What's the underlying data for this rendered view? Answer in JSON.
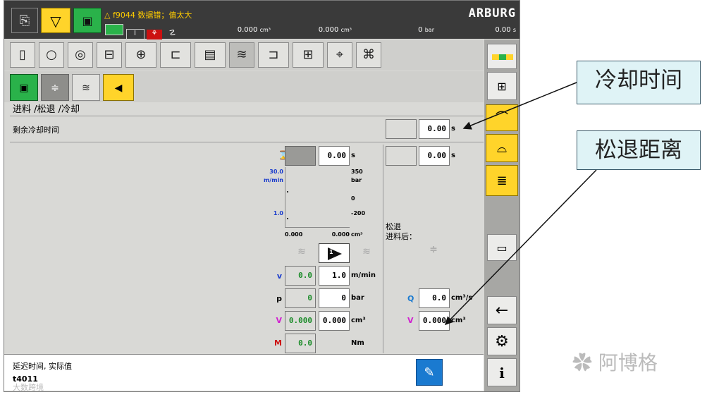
{
  "topbar": {
    "alarm_text": "f9044 数据错；值太大",
    "brand": "ARBURG",
    "readout1": "0.000",
    "readout1_unit": "cm³",
    "readout2": "0.000",
    "readout2_unit": "cm³",
    "readout3": "0",
    "readout3_unit": "bar",
    "readout4": "0.00",
    "readout4_unit": "s"
  },
  "breadcrumb": "进料 /松退 /冷却",
  "remaining_cooling": {
    "label": "剩余冷却时间",
    "value": "0.00",
    "unit": "s"
  },
  "left_time": {
    "value": "0.00",
    "unit": "s"
  },
  "right_time": {
    "value": "0.00",
    "unit": "s"
  },
  "graph": {
    "y_top_left": "30.0",
    "y_top_left_unit": "m/min",
    "y_mid_left": "1.0",
    "y_top_right": "350",
    "y_top_right_unit": "bar",
    "y_mid_right": "0",
    "y_bot_right": "-200",
    "x_left": "0.000",
    "x_right": "0.000",
    "x_unit": "cm³"
  },
  "step_number": "1",
  "params": {
    "v": {
      "label": "v",
      "actual": "0.0",
      "set": "1.0",
      "unit": "m/min"
    },
    "p": {
      "label": "p",
      "actual": "0",
      "set": "0",
      "unit": "bar"
    },
    "V": {
      "label": "V",
      "actual": "0.000",
      "set": "0.000",
      "unit": "cm³"
    },
    "M": {
      "label": "M",
      "actual": "0.0",
      "unit": "Nm"
    }
  },
  "decompression": {
    "title": "松退",
    "subtitle": "进料后：",
    "Q_label": "Q",
    "Q_value": "0.0",
    "Q_unit": "cm³/s",
    "V_label": "V",
    "V_value": "0.000",
    "V_unit": "cm³"
  },
  "status": {
    "line1": "延迟时间, 实际值",
    "line2": "t4011"
  },
  "watermark_left": "大数跨境",
  "watermark_right": "阿博格",
  "callouts": {
    "cooling_time": "冷却时间",
    "decompression_distance": "松退距离"
  },
  "colors": {
    "yellow": "#ffd42a",
    "green": "#2ab24a",
    "blue": "#1a3ccc",
    "magenta": "#d020d0",
    "red": "#cc1010"
  }
}
